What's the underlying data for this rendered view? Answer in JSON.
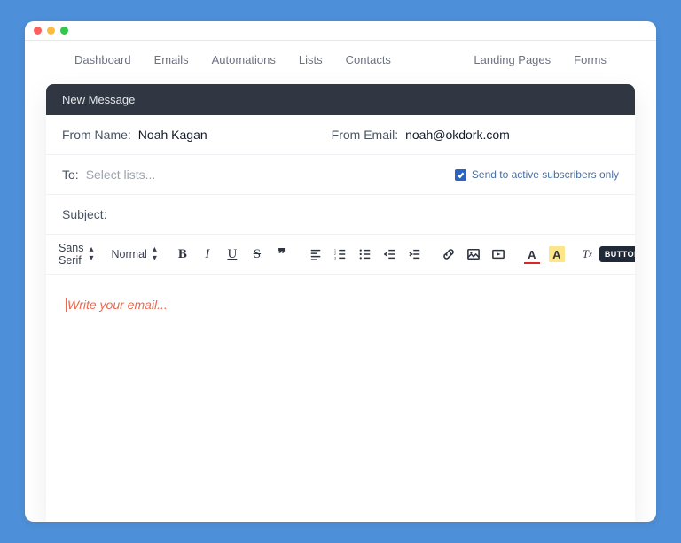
{
  "nav": {
    "left": [
      "Dashboard",
      "Emails",
      "Automations",
      "Lists",
      "Contacts"
    ],
    "right": [
      "Landing Pages",
      "Forms"
    ]
  },
  "compose": {
    "header": "New Message",
    "from_name_label": "From Name:",
    "from_name_value": "Noah Kagan",
    "from_email_label": "From Email:",
    "from_email_value": "noah@okdork.com",
    "to_label": "To:",
    "to_placeholder": "Select lists...",
    "active_only_label": "Send to active subscribers only",
    "active_only_checked": true,
    "subject_label": "Subject:",
    "subject_value": ""
  },
  "toolbar": {
    "font_family": "Sans Serif",
    "font_size": "Normal",
    "button_label": "BUTTON"
  },
  "editor": {
    "placeholder": "Write your email..."
  }
}
